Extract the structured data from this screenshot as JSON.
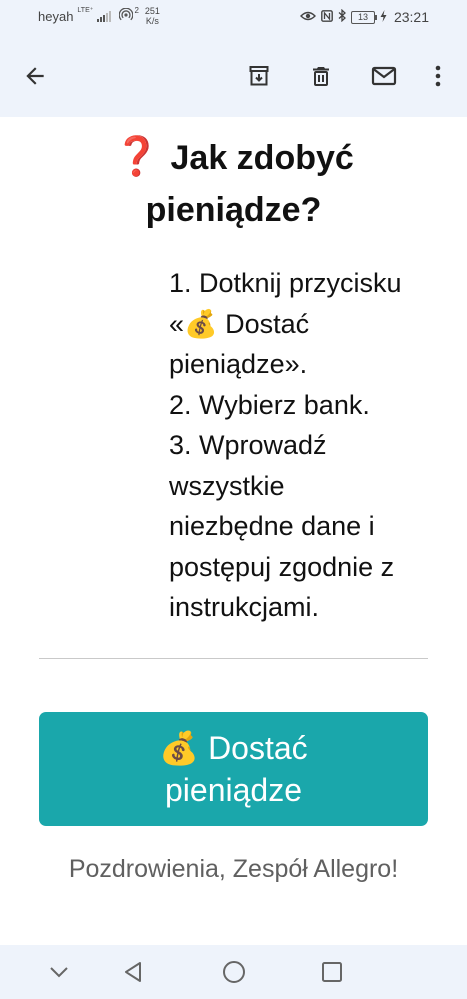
{
  "status_bar": {
    "carrier": "heyah",
    "network_type": "LTE⁺",
    "hotspot_connections": "2",
    "net_speed_value": "251",
    "net_speed_unit": "K/s",
    "battery": "13",
    "time": "23:21"
  },
  "toolbar": {
    "icons": [
      "back-arrow-icon",
      "archive-icon",
      "delete-icon",
      "mail-icon",
      "more-vert-icon"
    ]
  },
  "email": {
    "heading_emoji": "❓",
    "heading_line1": "Jak zdobyć",
    "heading_line2": "pieniądze?",
    "steps": [
      "1. Dotknij przycisku",
      "«💰 Dostać",
      "pieniądze».",
      "2. Wybierz bank.",
      "3. Wprowadź",
      "wszystkie",
      "niezbędne dane i",
      "postępuj zgodnie z",
      "instrukcjami."
    ],
    "cta_line1": "💰 Dostać",
    "cta_line2": "pieniądze",
    "signature": "Pozdrowienia, Zespół Allegro!",
    "colors": {
      "cta_background": "#1aa7ab",
      "cta_text": "#ffffff",
      "heading_emoji": "#e53935",
      "signature": "#606060",
      "bars_background": "#eef3fb"
    }
  },
  "nav_bar": {
    "icons": [
      "chevron-down-icon",
      "back-triangle-icon",
      "home-circle-icon",
      "recents-square-icon"
    ]
  }
}
